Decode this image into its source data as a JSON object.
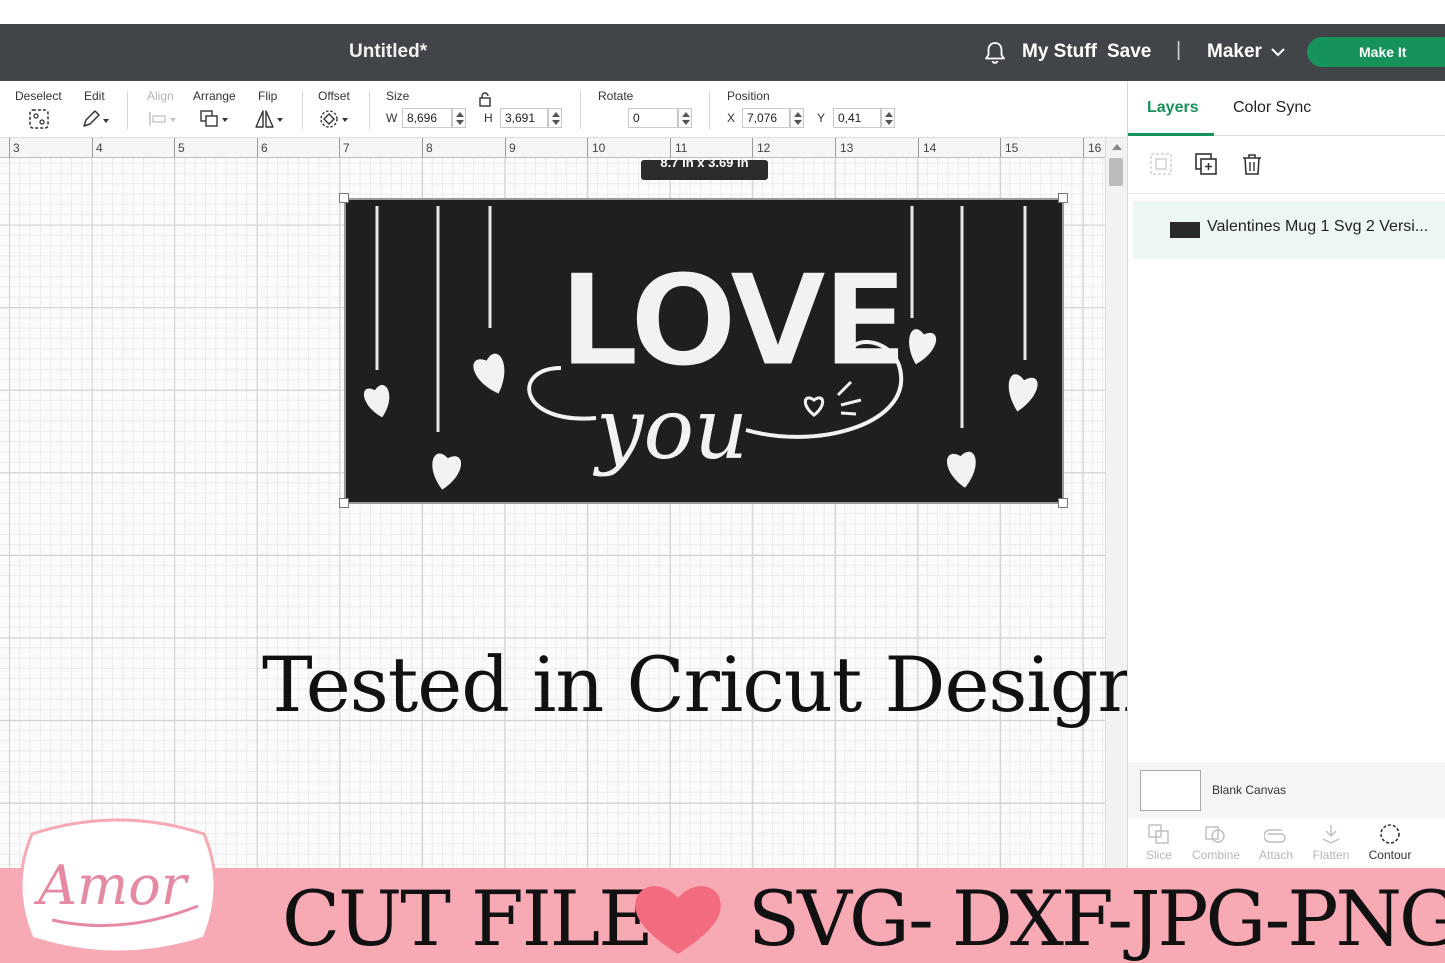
{
  "header": {
    "title": "Untitled*",
    "my_stuff": "My Stuff",
    "save": "Save",
    "separator": "|",
    "machine": "Maker",
    "make_it": "Make It",
    "accent_color": "#16935b",
    "icons": [
      "bell-icon",
      "chevron-down-icon"
    ]
  },
  "toolbar": {
    "deselect": "Deselect",
    "edit": "Edit",
    "align": "Align",
    "arrange": "Arrange",
    "flip": "Flip",
    "offset": "Offset",
    "size": "Size",
    "width_label": "W",
    "width_value": "8,696",
    "height_label": "H",
    "height_value": "3,691",
    "rotate": "Rotate",
    "rotate_value": "0",
    "position": "Position",
    "x_label": "X",
    "x_value": "7,076",
    "y_label": "Y",
    "y_value": "0,41"
  },
  "ruler": {
    "numbers": [
      "3",
      "4",
      "5",
      "6",
      "7",
      "8",
      "9",
      "10",
      "11",
      "12",
      "13",
      "14",
      "15",
      "16"
    ]
  },
  "canvas": {
    "dimensions_tooltip": "8.7 in x 3.69 in",
    "design_text": [
      "LOVE",
      "you"
    ]
  },
  "panel": {
    "tab_layers": "Layers",
    "tab_color_sync": "Color Sync",
    "layer_name": "Valentines Mug 1 Svg 2 Versi...",
    "blank_canvas": "Blank Canvas",
    "bottom_tools": [
      "Slice",
      "Combine",
      "Attach",
      "Flatten",
      "Contour"
    ]
  },
  "overlay": {
    "tested_text": "Tested in Cricut Design Space"
  },
  "banner": {
    "logo_text": "Amor",
    "cut_file": "CUT FILE",
    "formats": "SVG- DXF-JPG-PNG",
    "banner_color": "#f7a9b4",
    "heart_color": "#f26b7f"
  }
}
